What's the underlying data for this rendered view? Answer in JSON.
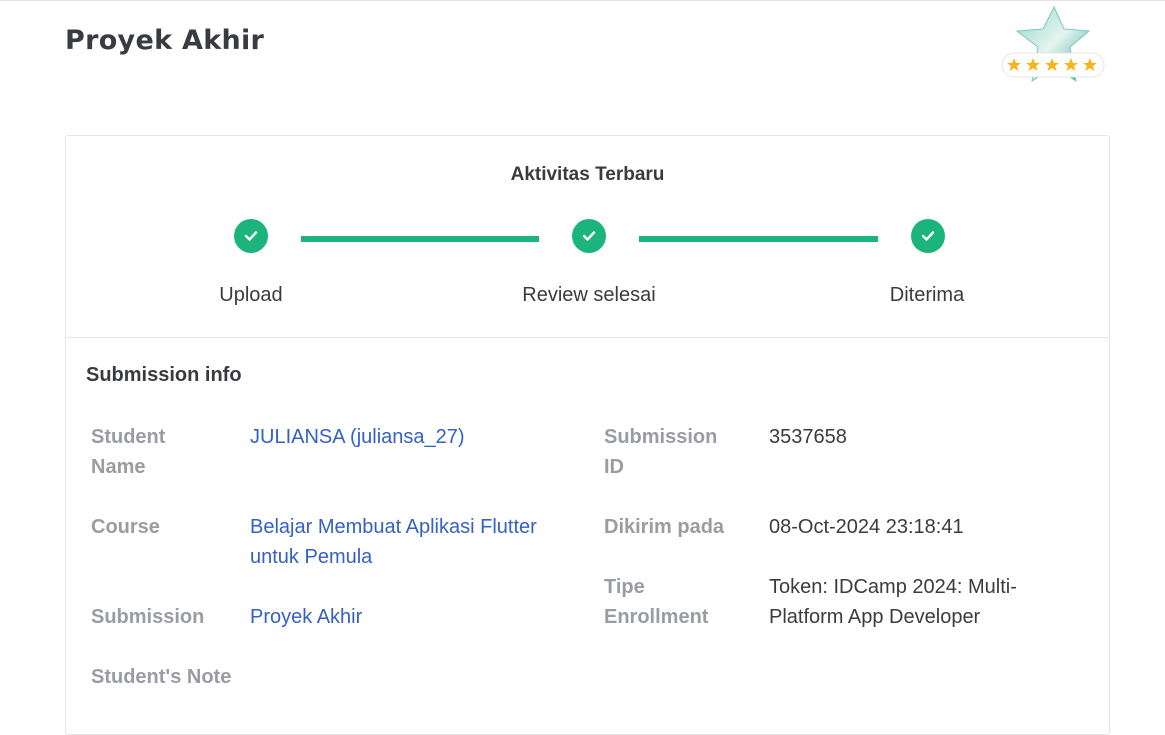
{
  "page": {
    "title": "Proyek Akhir"
  },
  "rating": {
    "stars": 5
  },
  "activity": {
    "title": "Aktivitas Terbaru",
    "steps": [
      {
        "label": "Upload",
        "done": true
      },
      {
        "label": "Review selesai",
        "done": true
      },
      {
        "label": "Diterima",
        "done": true
      }
    ]
  },
  "submission_info": {
    "title": "Submission info",
    "student_name_label": "Student Name",
    "student_name_value": "JULIANSA (juliansa_27)",
    "course_label": "Course",
    "course_value": "Belajar Membuat Aplikasi Flutter untuk Pemula",
    "submission_label": "Submission",
    "submission_value": "Proyek Akhir",
    "student_note_label": "Student's Note",
    "submission_id_label": "Submission ID",
    "submission_id_value": "3537658",
    "sent_at_label": "Dikirim pada",
    "sent_at_value": "08-Oct-2024 23:18:41",
    "enrollment_type_label": "Tipe Enrollment",
    "enrollment_type_value": "Token: IDCamp 2024: Multi-Platform App Developer"
  },
  "colors": {
    "accent": "#1bb47d",
    "link": "#3461c4",
    "label": "#9a9ca3",
    "star": "#f5b51c"
  },
  "icons": {
    "step": "check-circle-icon",
    "badge": "star-rating-badge-icon"
  }
}
